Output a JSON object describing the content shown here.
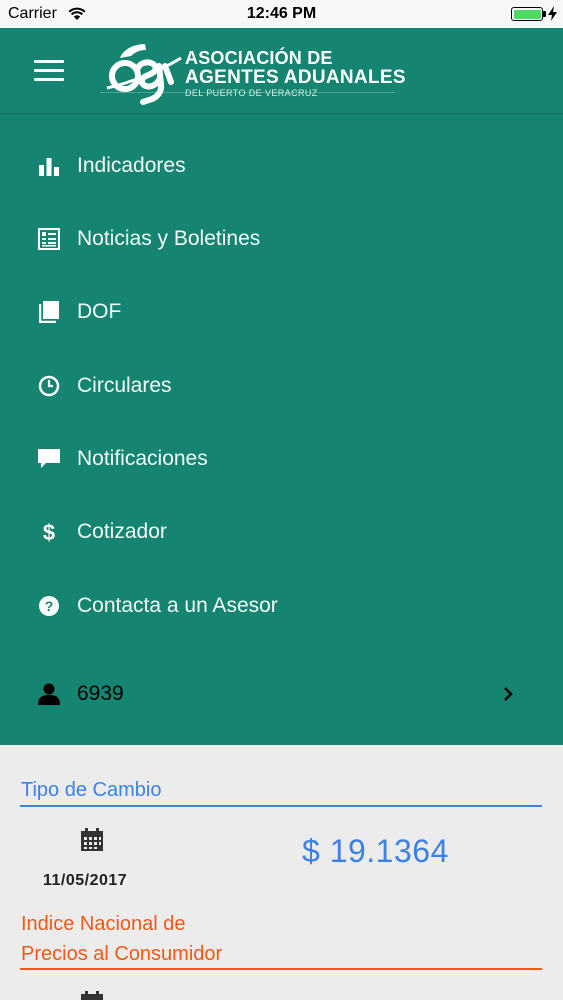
{
  "status_bar": {
    "carrier": "Carrier",
    "time": "12:46 PM",
    "battery_level": 1.0
  },
  "header": {
    "menu_icon": "hamburger-icon",
    "logo": {
      "line1": "ASOCIACIÓN DE",
      "line2": "AGENTES ADUANALES",
      "line3": "DEL PUERTO DE VERACRUZ"
    }
  },
  "menu": {
    "items": [
      {
        "icon": "bar-chart-icon",
        "label": "Indicadores"
      },
      {
        "icon": "newspaper-icon",
        "label": "Noticias y Boletines"
      },
      {
        "icon": "book-icon",
        "label": "DOF"
      },
      {
        "icon": "clock-icon",
        "label": "Circulares"
      },
      {
        "icon": "comment-icon",
        "label": "Notificaciones"
      },
      {
        "icon": "dollar-icon",
        "label": "Cotizador"
      },
      {
        "icon": "question-circle-icon",
        "label": "Contacta a un Asesor"
      }
    ],
    "user": {
      "icon": "user-icon",
      "label": "6939",
      "chevron": "chevron-right-icon"
    }
  },
  "tipo_cambio": {
    "title": "Tipo de Cambio",
    "date": "11/05/2017",
    "value": "$ 19.1364"
  },
  "inpc": {
    "title_line1": "Indice Nacional de",
    "title_line2": "Precios al Consumidor"
  },
  "colors": {
    "drawer": "#158470",
    "blue": "#3b82e6",
    "orange": "#f05a14",
    "background": "#ececec"
  }
}
